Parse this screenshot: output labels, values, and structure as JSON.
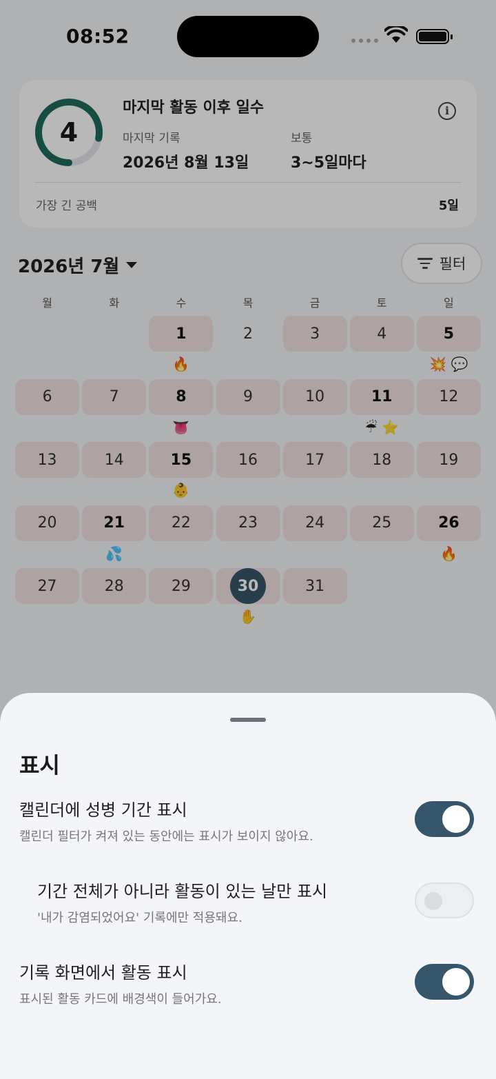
{
  "status_bar": {
    "time": "08:52"
  },
  "summary": {
    "count": "4",
    "title": "마지막 활동 이후 일수",
    "last_label": "마지막 기록",
    "last_value": "2026년 8월 13일",
    "usual_label": "보통",
    "usual_value": "3~5일마다",
    "gap_label": "가장 긴 공백",
    "gap_value": "5일",
    "ring_color": "#1e6b5c",
    "ring_progress": 0.78
  },
  "calendar": {
    "month_label": "2026년 7월",
    "filter_label": "필터",
    "weekdays": [
      "월",
      "화",
      "수",
      "목",
      "금",
      "토",
      "일"
    ],
    "days": [
      {
        "d": "1",
        "hl": true,
        "bold": true,
        "emoji": "🔥"
      },
      {
        "d": "2",
        "hl": false,
        "bold": false,
        "emoji": ""
      },
      {
        "d": "3",
        "hl": true,
        "bold": false,
        "emoji": ""
      },
      {
        "d": "4",
        "hl": true,
        "bold": false,
        "emoji": ""
      },
      {
        "d": "5",
        "hl": true,
        "bold": true,
        "emoji": "💥 💬"
      },
      {
        "d": "6",
        "hl": true,
        "bold": false,
        "emoji": ""
      },
      {
        "d": "7",
        "hl": true,
        "bold": false,
        "emoji": ""
      },
      {
        "d": "8",
        "hl": true,
        "bold": true,
        "emoji": "👅"
      },
      {
        "d": "9",
        "hl": true,
        "bold": false,
        "emoji": ""
      },
      {
        "d": "10",
        "hl": true,
        "bold": false,
        "emoji": ""
      },
      {
        "d": "11",
        "hl": true,
        "bold": true,
        "emoji": "☔ ⭐"
      },
      {
        "d": "12",
        "hl": true,
        "bold": false,
        "emoji": ""
      },
      {
        "d": "13",
        "hl": true,
        "bold": false,
        "emoji": ""
      },
      {
        "d": "14",
        "hl": true,
        "bold": false,
        "emoji": ""
      },
      {
        "d": "15",
        "hl": true,
        "bold": true,
        "emoji": "👶"
      },
      {
        "d": "16",
        "hl": true,
        "bold": false,
        "emoji": ""
      },
      {
        "d": "17",
        "hl": true,
        "bold": false,
        "emoji": ""
      },
      {
        "d": "18",
        "hl": true,
        "bold": false,
        "emoji": ""
      },
      {
        "d": "19",
        "hl": true,
        "bold": false,
        "emoji": ""
      },
      {
        "d": "20",
        "hl": true,
        "bold": false,
        "emoji": ""
      },
      {
        "d": "21",
        "hl": true,
        "bold": true,
        "emoji": "💦"
      },
      {
        "d": "22",
        "hl": true,
        "bold": false,
        "emoji": ""
      },
      {
        "d": "23",
        "hl": true,
        "bold": false,
        "emoji": ""
      },
      {
        "d": "24",
        "hl": true,
        "bold": false,
        "emoji": ""
      },
      {
        "d": "25",
        "hl": true,
        "bold": false,
        "emoji": ""
      },
      {
        "d": "26",
        "hl": true,
        "bold": true,
        "emoji": "🔥"
      },
      {
        "d": "27",
        "hl": true,
        "bold": false,
        "emoji": ""
      },
      {
        "d": "28",
        "hl": true,
        "bold": false,
        "emoji": ""
      },
      {
        "d": "29",
        "hl": true,
        "bold": false,
        "emoji": ""
      },
      {
        "d": "30",
        "hl": true,
        "bold": true,
        "today": true,
        "emoji": "✋"
      },
      {
        "d": "31",
        "hl": true,
        "bold": false,
        "emoji": ""
      }
    ],
    "highlight_color": "#f3e1e1",
    "today_color": "#37566b"
  },
  "sheet": {
    "title": "표시",
    "options": [
      {
        "title": "캘린더에 성병 기간 표시",
        "desc": "캘린더 필터가 켜져 있는 동안에는 표시가 보이지 않아요.",
        "on": true
      },
      {
        "title": "기간 전체가 아니라 활동이 있는 날만 표시",
        "desc": "'내가 감염되었어요' 기록에만 적용돼요.",
        "on": false
      },
      {
        "title": "기록 화면에서 활동 표시",
        "desc": "표시된 활동 카드에 배경색이 들어가요.",
        "on": true
      }
    ],
    "toggle_on_color": "#37566b"
  }
}
